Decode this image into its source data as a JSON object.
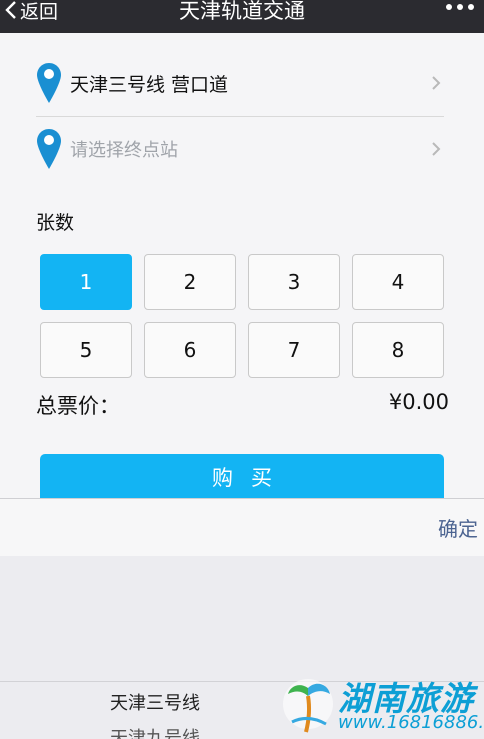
{
  "header": {
    "back_label": "返回",
    "title": "天津轨道交通"
  },
  "route": {
    "origin": "天津三号线 营口道",
    "destination_placeholder": "请选择终点站"
  },
  "tickets": {
    "label": "张数",
    "options": [
      "1",
      "2",
      "3",
      "4",
      "5",
      "6",
      "7",
      "8"
    ],
    "selected": "1"
  },
  "total": {
    "label": "总票价：",
    "value": "¥0.00"
  },
  "buy_label": "购买",
  "picker": {
    "confirm_label": "确定",
    "items": [
      "天津三号线",
      "天津九号线"
    ]
  },
  "watermark": {
    "text": "湖南旅游",
    "url": "www.16816886.cn"
  },
  "colors": {
    "accent": "#13b4f3",
    "topbar": "#2b2b30",
    "confirm": "#4c6491"
  }
}
